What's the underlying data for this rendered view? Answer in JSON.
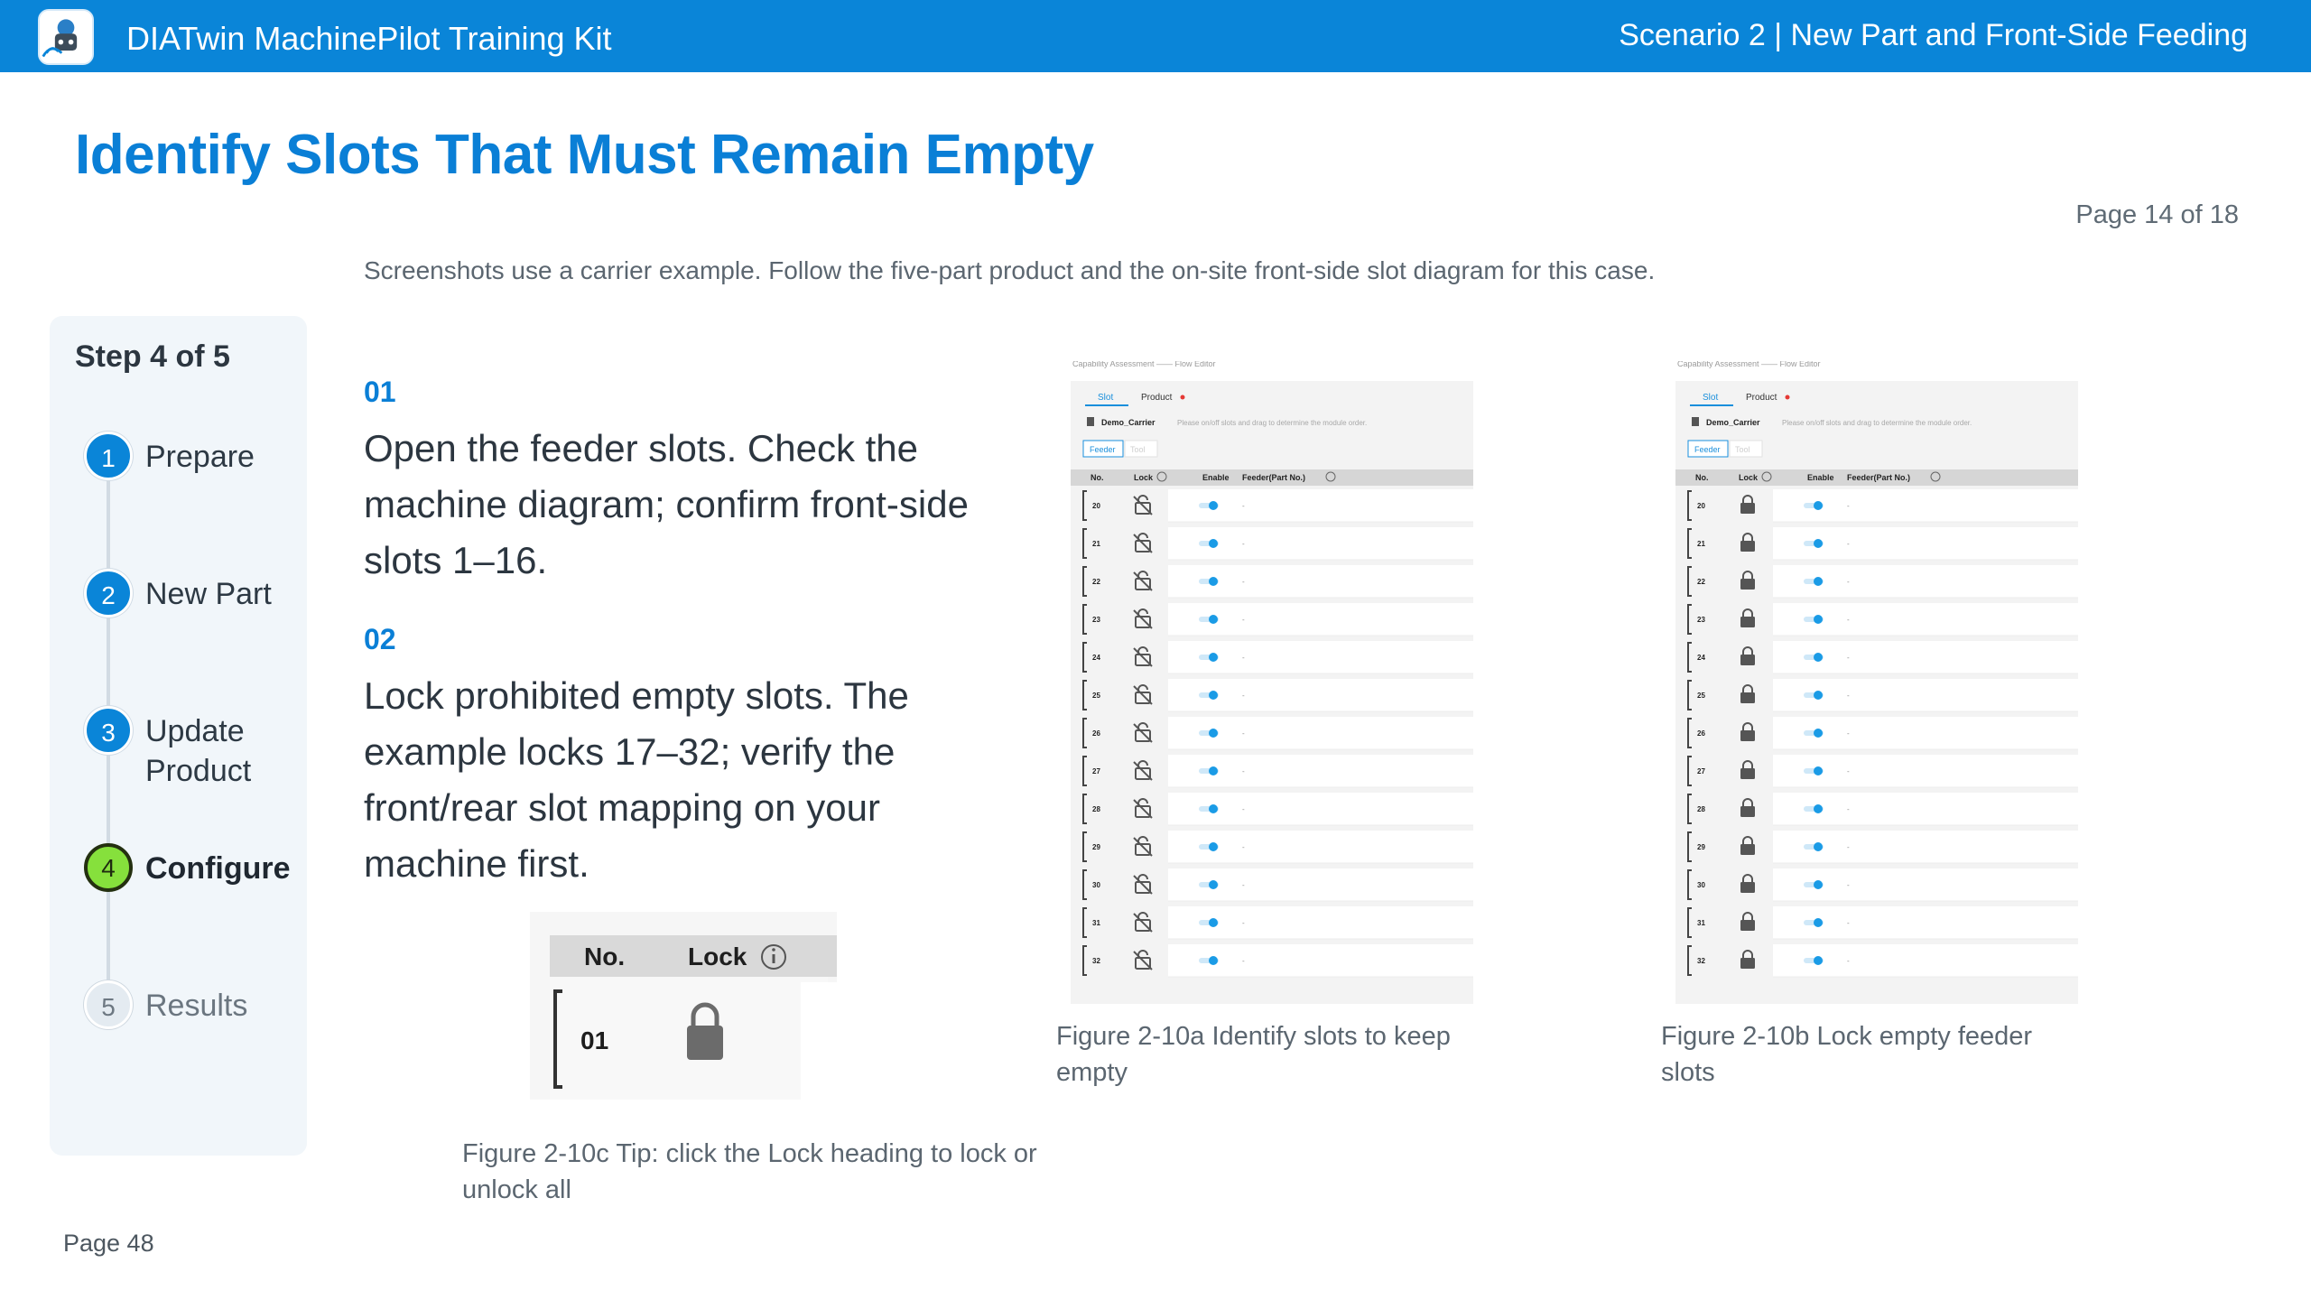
{
  "header": {
    "app_title": "DIATwin MachinePilot Training Kit",
    "scenario": "Scenario 2 | New Part and Front-Side Feeding",
    "logo_icon": "robot-arm-logo-icon"
  },
  "page": {
    "title": "Identify Slots That Must Remain Empty",
    "page_count": "Page 14 of 18",
    "subtitle": "Screenshots use a carrier example. Follow the five-part product and the on-site front-side slot diagram for this case.",
    "footer_page": "Page 48"
  },
  "stepper": {
    "title": "Step 4 of 5",
    "steps": [
      {
        "num": "1",
        "label": "Prepare",
        "state": "done"
      },
      {
        "num": "2",
        "label": "New Part",
        "state": "done"
      },
      {
        "num": "3",
        "label": "Update Product",
        "state": "done"
      },
      {
        "num": "4",
        "label": "Configure",
        "state": "active"
      },
      {
        "num": "5",
        "label": "Results",
        "state": "pending"
      }
    ]
  },
  "instructions": [
    {
      "num": "01",
      "text": "Open the feeder slots. Check the machine diagram; confirm front-side slots 1–16."
    },
    {
      "num": "02",
      "text": "Lock prohibited empty slots. The example locks 17–32; verify the front/rear slot mapping on your machine first."
    }
  ],
  "figures": {
    "fig_a": {
      "caption": "Figure 2-10a  Identify slots to keep empty",
      "top_text": "Capability Assessment  ——  Flow Editor",
      "tab_slot": "Slot",
      "tab_product": "Product",
      "carrier": "Demo_Carrier",
      "hint": "Please on/off slots and drag to determine the module order.",
      "btn_feeder": "Feeder",
      "btn_tool": "Tool",
      "columns": [
        "No.",
        "Lock",
        "Enable",
        "Feeder(Part No.)"
      ],
      "rows": [
        "20",
        "21",
        "22",
        "23",
        "24",
        "25",
        "26",
        "27",
        "28",
        "29",
        "30",
        "31",
        "32"
      ],
      "lock_state": "unlocked"
    },
    "fig_b": {
      "caption": "Figure 2-10b  Lock empty feeder slots",
      "top_text": "Capability Assessment  ——  Flow Editor",
      "tab_slot": "Slot",
      "tab_product": "Product",
      "carrier": "Demo_Carrier",
      "hint": "Please on/off slots and drag to determine the module order.",
      "btn_feeder": "Feeder",
      "btn_tool": "Tool",
      "columns": [
        "No.",
        "Lock",
        "Enable",
        "Feeder(Part No.)"
      ],
      "rows": [
        "20",
        "21",
        "22",
        "23",
        "24",
        "25",
        "26",
        "27",
        "28",
        "29",
        "30",
        "31",
        "32"
      ],
      "lock_state": "locked"
    },
    "fig_c": {
      "caption": "Figure 2-10c  Tip: click the Lock heading to lock or unlock all",
      "col_no": "No.",
      "col_lock": "Lock",
      "row_no": "01"
    }
  },
  "colors": {
    "header_bg": "#0a85d8",
    "title_blue": "#0a7fd6",
    "active_step": "#86e03c",
    "toggle_blue": "#1a9be6"
  }
}
